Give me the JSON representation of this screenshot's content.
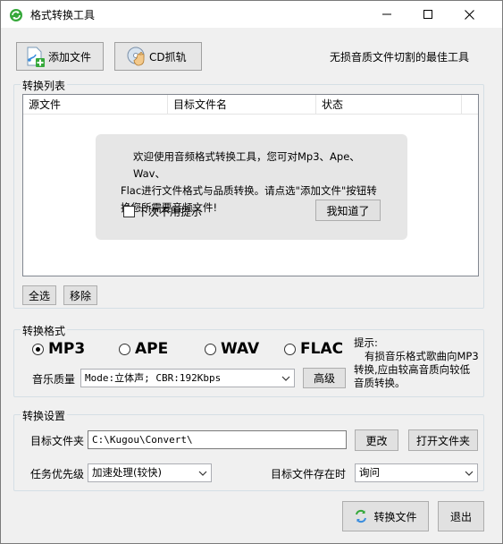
{
  "window": {
    "title": "格式转换工具",
    "colors": {
      "accent": "#3a8dde",
      "icon_green": "#35a83a"
    }
  },
  "toolbar": {
    "add_file_label": "添加文件",
    "add_file_icon": "add-file-icon",
    "cd_rip_label": "CD抓轨",
    "cd_rip_icon": "cd-hand-icon",
    "slogan": "无损音质文件切割的最佳工具"
  },
  "conversion_list": {
    "group_title": "转换列表",
    "columns": [
      "源文件",
      "目标文件名",
      "状态"
    ],
    "rows": [],
    "select_all_label": "全选",
    "remove_label": "移除"
  },
  "welcome_popup": {
    "line1": "欢迎使用音频格式转换工具，您可对Mp3、Ape、Wav、",
    "line2": "Flac进行文件格式与品质转换。请点选\"添加文件\"按钮转",
    "line3": "换您所需要音频文件!",
    "checkbox_label": "下次不用提示",
    "checkbox_checked": false,
    "ok_label": "我知道了"
  },
  "format": {
    "group_title": "转换格式",
    "options": [
      {
        "label": "MP3",
        "checked": true
      },
      {
        "label": "APE",
        "checked": false
      },
      {
        "label": "WAV",
        "checked": false
      },
      {
        "label": "FLAC",
        "checked": false
      }
    ],
    "quality_label": "音乐质量",
    "quality_value": "Mode:立体声; CBR:192Kbps",
    "advanced_label": "高级",
    "hint_title": "提示:",
    "hint_line1": "有损音乐格式歌曲向MP3",
    "hint_line2": "转换,应由较高音质向较低",
    "hint_line3": "音质转换。"
  },
  "settings": {
    "group_title": "转换设置",
    "target_folder_label": "目标文件夹",
    "target_folder_value": "C:\\Kugou\\Convert\\",
    "change_label": "更改",
    "open_folder_label": "打开文件夹",
    "priority_label": "任务优先级",
    "priority_value": "加速处理(较快)",
    "exists_label": "目标文件存在时",
    "exists_value": "询问"
  },
  "actions": {
    "convert_label": "转换文件",
    "exit_label": "退出"
  }
}
